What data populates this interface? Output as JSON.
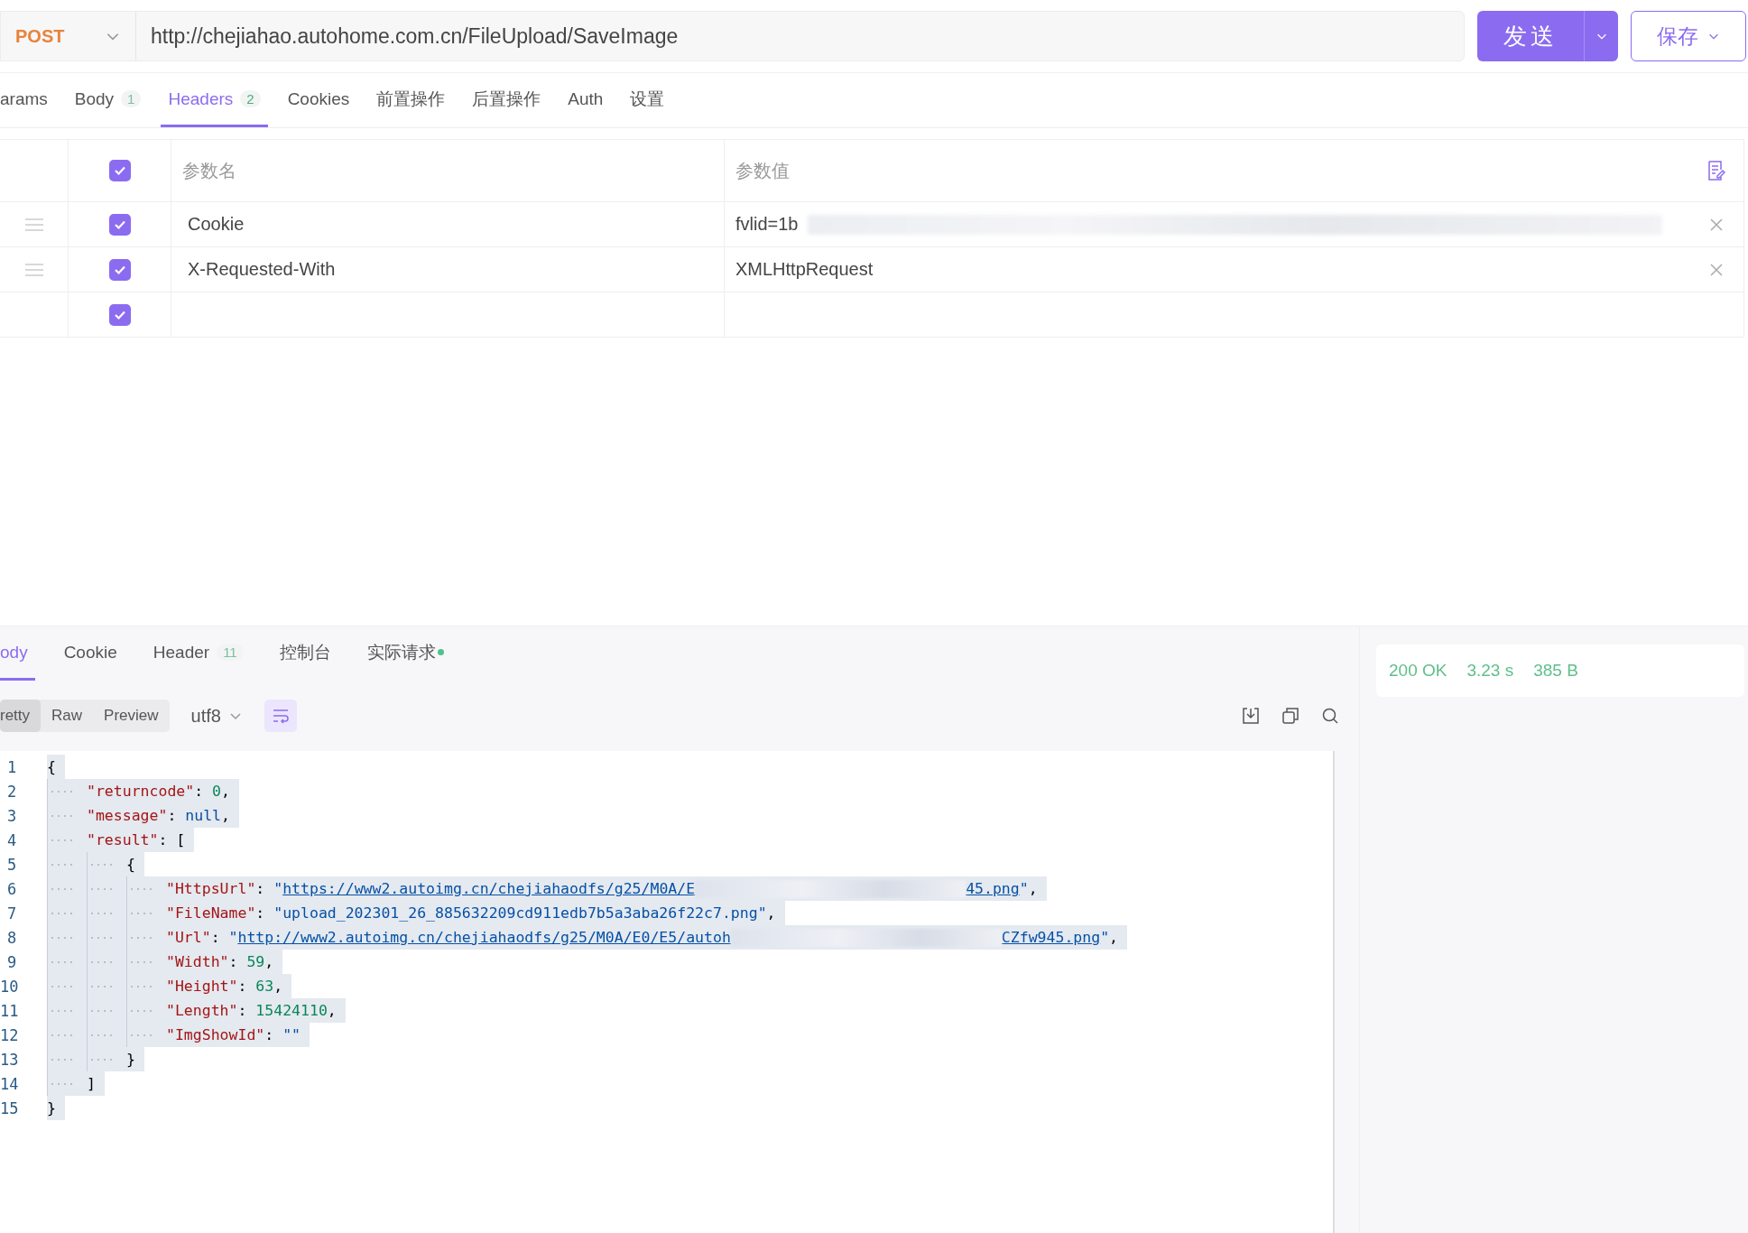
{
  "request": {
    "method": "POST",
    "url": "http://chejiahao.autohome.com.cn/FileUpload/SaveImage",
    "send_label": "发送",
    "save_label": "保存"
  },
  "request_tabs": [
    {
      "label": "arams",
      "selected": false
    },
    {
      "label": "Body",
      "badge": "1",
      "selected": false
    },
    {
      "label": "Headers",
      "badge": "2",
      "selected": true
    },
    {
      "label": "Cookies",
      "selected": false
    },
    {
      "label": "前置操作",
      "selected": false
    },
    {
      "label": "后置操作",
      "selected": false
    },
    {
      "label": "Auth",
      "selected": false
    },
    {
      "label": "设置",
      "selected": false
    }
  ],
  "headers_table": {
    "all_checked": true,
    "columns": [
      "参数名",
      "参数值"
    ],
    "rows": [
      {
        "checked": true,
        "name": "Cookie",
        "value": "fvlid=1b",
        "value_redacted": true
      },
      {
        "checked": true,
        "name": "X-Requested-With",
        "value": "XMLHttpRequest",
        "value_redacted": false
      },
      {
        "checked": true
      }
    ]
  },
  "response_tabs": [
    {
      "label": "ody",
      "selected": true
    },
    {
      "label": "Cookie",
      "selected": false
    },
    {
      "label": "Header",
      "badge": "11",
      "selected": false
    },
    {
      "label": "控制台",
      "selected": false
    },
    {
      "label": "实际请求",
      "dot": true,
      "selected": false
    }
  ],
  "view_modes": [
    {
      "label": "retty",
      "selected": true
    },
    {
      "label": "Raw",
      "selected": false
    },
    {
      "label": "Preview",
      "selected": false
    }
  ],
  "encoding": "utf8",
  "wrap_on": true,
  "code_lines": [
    {
      "number": "1",
      "tokens": [
        {
          "kind": "open",
          "text": "{"
        }
      ]
    },
    {
      "number": "2",
      "tokens": [
        {
          "kind": "key",
          "text": "\"returncode\""
        },
        {
          "kind": "punct",
          "text": ": "
        },
        {
          "kind": "number",
          "text": "0"
        },
        {
          "kind": "punct",
          "text": ","
        }
      ]
    },
    {
      "number": "3",
      "tokens": [
        {
          "kind": "key",
          "text": "\"message\""
        },
        {
          "kind": "punct",
          "text": ": "
        },
        {
          "kind": "null",
          "text": "null"
        },
        {
          "kind": "punct",
          "text": ","
        }
      ]
    },
    {
      "number": "4",
      "tokens": [
        {
          "kind": "key",
          "text": "\"result\""
        },
        {
          "kind": "punct",
          "text": ": "
        },
        {
          "kind": "open",
          "text": "["
        }
      ]
    },
    {
      "number": "5",
      "tokens": [
        {
          "kind": "open",
          "text": "{"
        }
      ]
    },
    {
      "number": "6",
      "tokens": [
        {
          "kind": "key",
          "text": "\"HttpsUrl\""
        },
        {
          "kind": "punct",
          "text": ": "
        },
        {
          "kind": "string",
          "text": "\""
        },
        {
          "kind": "link",
          "text": "https://www2.autoimg.cn/chejiahaodfs/g25/M0A/E"
        },
        {
          "kind": "redacted"
        },
        {
          "kind": "link",
          "text": "45.png"
        },
        {
          "kind": "string",
          "text": "\""
        },
        {
          "kind": "punct",
          "text": ","
        }
      ]
    },
    {
      "number": "7",
      "tokens": [
        {
          "kind": "key",
          "text": "\"FileName\""
        },
        {
          "kind": "punct",
          "text": ": "
        },
        {
          "kind": "string",
          "text": "\"upload_202301_26_885632209cd911edb7b5a3aba26f22c7.png\""
        },
        {
          "kind": "punct",
          "text": ","
        }
      ]
    },
    {
      "number": "8",
      "tokens": [
        {
          "kind": "key",
          "text": "\"Url\""
        },
        {
          "kind": "punct",
          "text": ": "
        },
        {
          "kind": "string",
          "text": "\""
        },
        {
          "kind": "link",
          "text": "http://www2.autoimg.cn/chejiahaodfs/g25/M0A/E0/E5/autoh"
        },
        {
          "kind": "redacted"
        },
        {
          "kind": "link",
          "text": "CZfw945.png"
        },
        {
          "kind": "string",
          "text": "\""
        },
        {
          "kind": "punct",
          "text": ","
        }
      ]
    },
    {
      "number": "9",
      "tokens": [
        {
          "kind": "key",
          "text": "\"Width\""
        },
        {
          "kind": "punct",
          "text": ": "
        },
        {
          "kind": "number",
          "text": "59"
        },
        {
          "kind": "punct",
          "text": ","
        }
      ]
    },
    {
      "number": "10",
      "tokens": [
        {
          "kind": "key",
          "text": "\"Height\""
        },
        {
          "kind": "punct",
          "text": ": "
        },
        {
          "kind": "number",
          "text": "63"
        },
        {
          "kind": "punct",
          "text": ","
        }
      ]
    },
    {
      "number": "11",
      "tokens": [
        {
          "kind": "key",
          "text": "\"Length\""
        },
        {
          "kind": "punct",
          "text": ": "
        },
        {
          "kind": "number",
          "text": "15424110"
        },
        {
          "kind": "punct",
          "text": ","
        }
      ]
    },
    {
      "number": "12",
      "tokens": [
        {
          "kind": "key",
          "text": "\"ImgShowId\""
        },
        {
          "kind": "punct",
          "text": ": "
        },
        {
          "kind": "string",
          "text": "\"\""
        }
      ]
    },
    {
      "number": "13",
      "tokens": [
        {
          "kind": "close",
          "text": "}"
        }
      ]
    },
    {
      "number": "14",
      "tokens": [
        {
          "kind": "close",
          "text": "]"
        }
      ]
    },
    {
      "number": "15",
      "tokens": [
        {
          "kind": "close",
          "text": "}"
        }
      ]
    }
  ],
  "status": {
    "code": "200 OK",
    "time": "3.23 s",
    "size": "385 B"
  }
}
